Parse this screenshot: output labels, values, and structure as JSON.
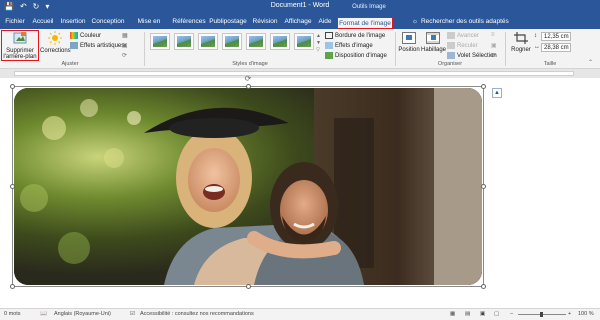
{
  "window": {
    "title": "Document1 - Word",
    "context_group": "Outils Image"
  },
  "tabs": [
    {
      "label": "Fichier"
    },
    {
      "label": "Accueil"
    },
    {
      "label": "Insertion"
    },
    {
      "label": "Conception"
    },
    {
      "label": "Mise en page"
    },
    {
      "label": "Références"
    },
    {
      "label": "Publipostage"
    },
    {
      "label": "Révision"
    },
    {
      "label": "Affichage"
    },
    {
      "label": "Aide"
    },
    {
      "label": "Format de l'image"
    }
  ],
  "search": {
    "label": "Rechercher des outils adaptés"
  },
  "ribbon": {
    "adjust": {
      "remove_bg": "Supprimer l'arrière-plan",
      "corrections": "Corrections",
      "color": "Couleur",
      "artistic": "Effets artistiques",
      "group": "Ajuster"
    },
    "styles": {
      "border": "Bordure de l'image",
      "effects": "Effets d'image",
      "layout": "Disposition d'image",
      "group": "Styles d'image"
    },
    "arrange": {
      "position": "Position",
      "wrap": "Habillage",
      "forward": "Avancer",
      "backward": "Reculer",
      "selection": "Volet Sélection",
      "group": "Organiser"
    },
    "size": {
      "crop": "Rogner",
      "height": "12,35 cm",
      "width": "28,38 cm",
      "group": "Taille"
    }
  },
  "status": {
    "words": "0 mots",
    "language": "Anglais (Royaume-Uni)",
    "accessibility": "Accessibilité : consultez nos recommandations",
    "zoom": "100 %"
  },
  "colors": {
    "accent": "#2b579a",
    "highlight": "#e4161b"
  }
}
